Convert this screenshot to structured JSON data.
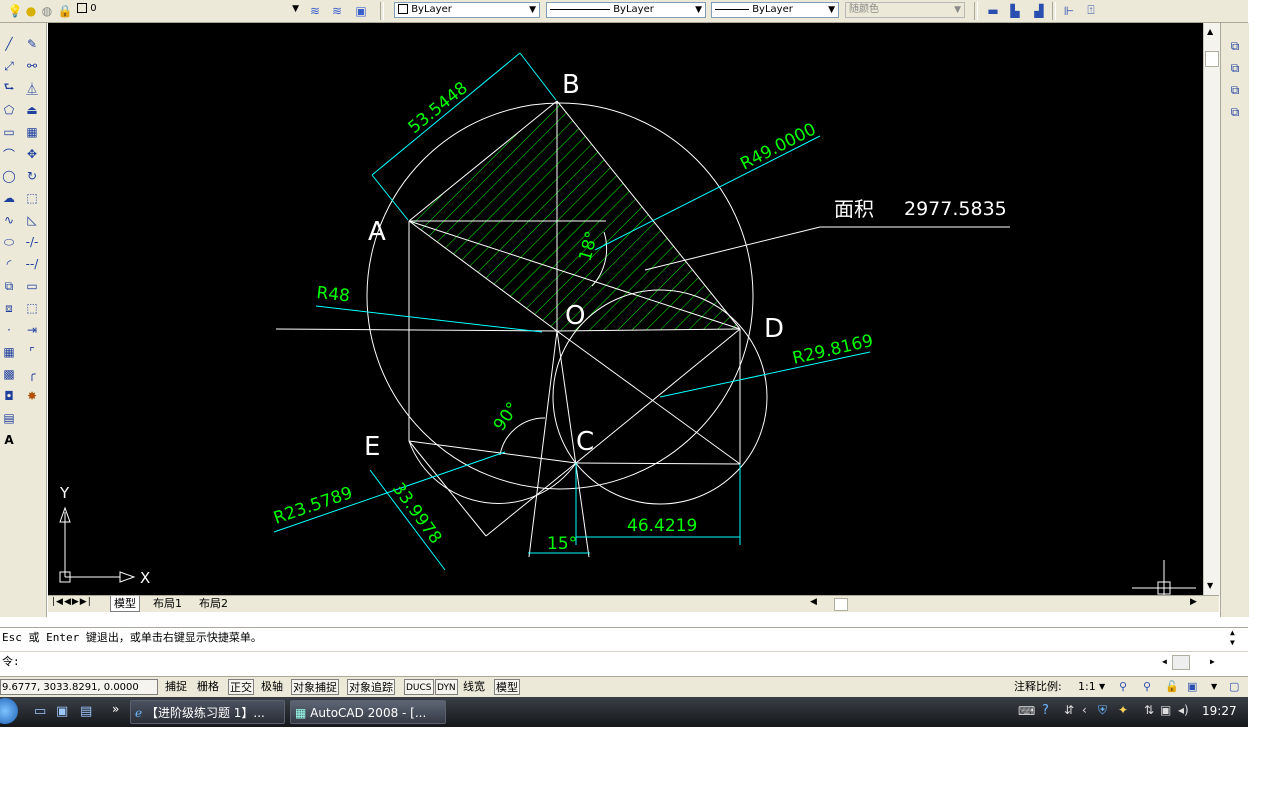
{
  "toolbar": {
    "layer_name": "0",
    "color_select": "ByLayer",
    "linetype_select": "ByLayer",
    "lineweight_select": "ByLayer",
    "plotstyle_select": "随颜色"
  },
  "drawing": {
    "points": {
      "A": "A",
      "B": "B",
      "C": "C",
      "D": "D",
      "E": "E",
      "O": "O"
    },
    "dims": {
      "d1": "53.5448",
      "d2": "R49.0000",
      "d3": "R48",
      "d4": "R29.8169",
      "d5": "R23.5789",
      "d6": "33.9978",
      "d7": "15°",
      "d8": "46.4219",
      "d9": "90°",
      "d10": "18°"
    },
    "area_label": "面积",
    "area_value": "2977.5835",
    "ucs_x": "X",
    "ucs_y": "Y"
  },
  "tabs": [
    "模型",
    "布局1",
    "布局2"
  ],
  "command": {
    "history": "Esc 或 Enter 键退出，或单击右键显示快捷菜单。",
    "prompt": "令:"
  },
  "status": {
    "coords": "9.6777, 3033.8291, 0.0000",
    "buttons": [
      "捕捉",
      "栅格",
      "正交",
      "极轴",
      "对象捕捉",
      "对象追踪",
      "DUCS",
      "DYN",
      "线宽",
      "模型"
    ],
    "annotation_scale_label": "注释比例:",
    "annotation_scale_value": "1:1"
  },
  "taskbar": {
    "task1": "【进阶级练习题 1】...",
    "task2": "AutoCAD 2008 - [...",
    "clock": "19:27"
  },
  "colors": {
    "drawing_bg": "#000000",
    "geometry": "#ffffff",
    "dimension": "#00ffff",
    "dim_text": "#00ff00",
    "hatch": "#00ff00"
  }
}
